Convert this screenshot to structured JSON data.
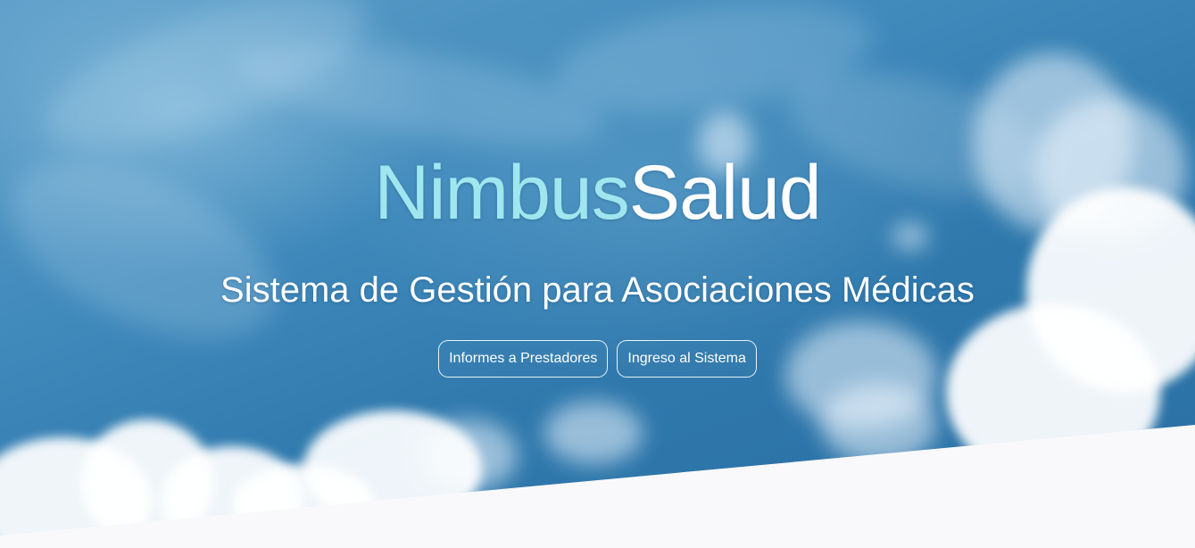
{
  "hero": {
    "brand_part_a": "Nimbus",
    "brand_part_b": "Salud",
    "subtitle": "Sistema de Gestión para Asociaciones Médicas",
    "buttons": [
      {
        "label": "Informes a Prestadores"
      },
      {
        "label": "Ingreso al Sistema"
      }
    ]
  },
  "colors": {
    "sky": "#3f89bb",
    "brand_accent": "#9fe6ee",
    "brand_main": "#ffffff",
    "footer_band": "#f9f9fb"
  }
}
